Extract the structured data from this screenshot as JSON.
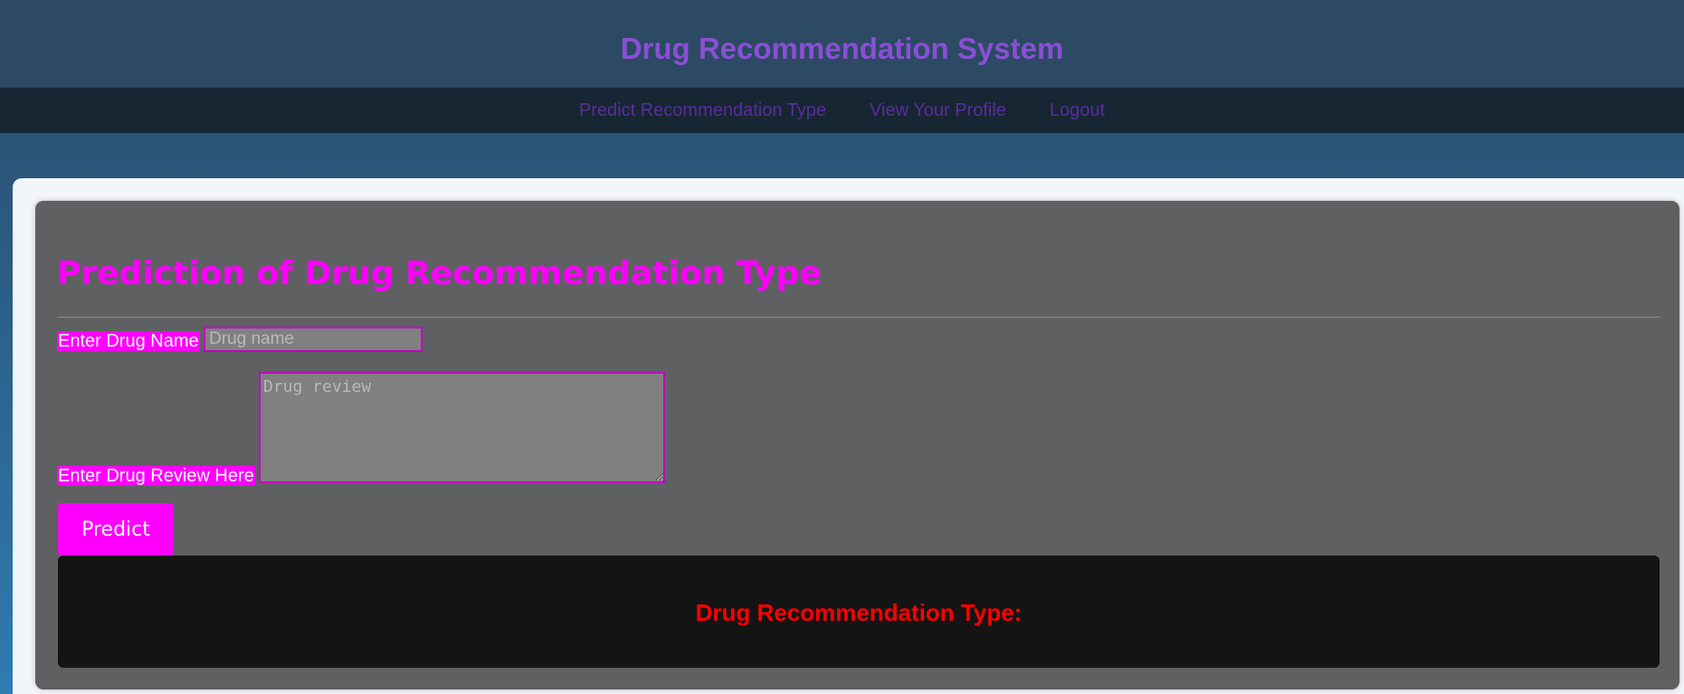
{
  "header": {
    "title": "Drug Recommendation System"
  },
  "nav": {
    "items": [
      {
        "label": "Predict Recommendation Type"
      },
      {
        "label": "View Your Profile"
      },
      {
        "label": "Logout"
      }
    ]
  },
  "form": {
    "title": "Prediction of Drug Recommendation Type",
    "drug_name_label": "Enter Drug Name",
    "drug_name_placeholder": "Drug name",
    "drug_name_value": "",
    "review_label": "Enter Drug Review Here",
    "review_placeholder": "Drug review",
    "review_value": "",
    "predict_label": "Predict"
  },
  "result": {
    "title": "Drug Recommendation Type:"
  },
  "colors": {
    "accent": "#ff00ff",
    "title": "#8a4fd6",
    "nav_link": "#5a2d9c",
    "result_text": "#ff0000"
  }
}
